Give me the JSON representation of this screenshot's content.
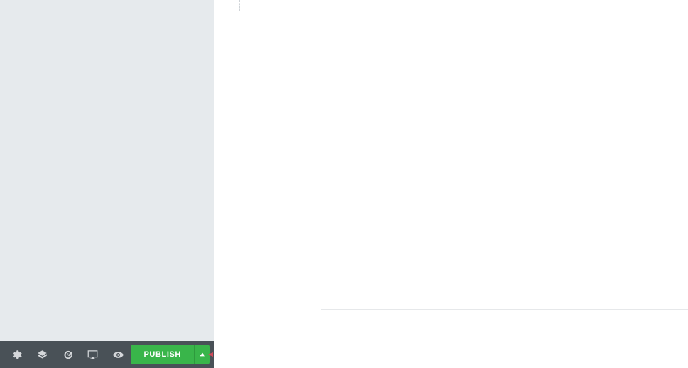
{
  "footer": {
    "publish_label": "PUBLISH",
    "icons": [
      "settings",
      "navigator",
      "history",
      "responsive",
      "preview"
    ]
  },
  "publish_button_color": "#39b54a"
}
